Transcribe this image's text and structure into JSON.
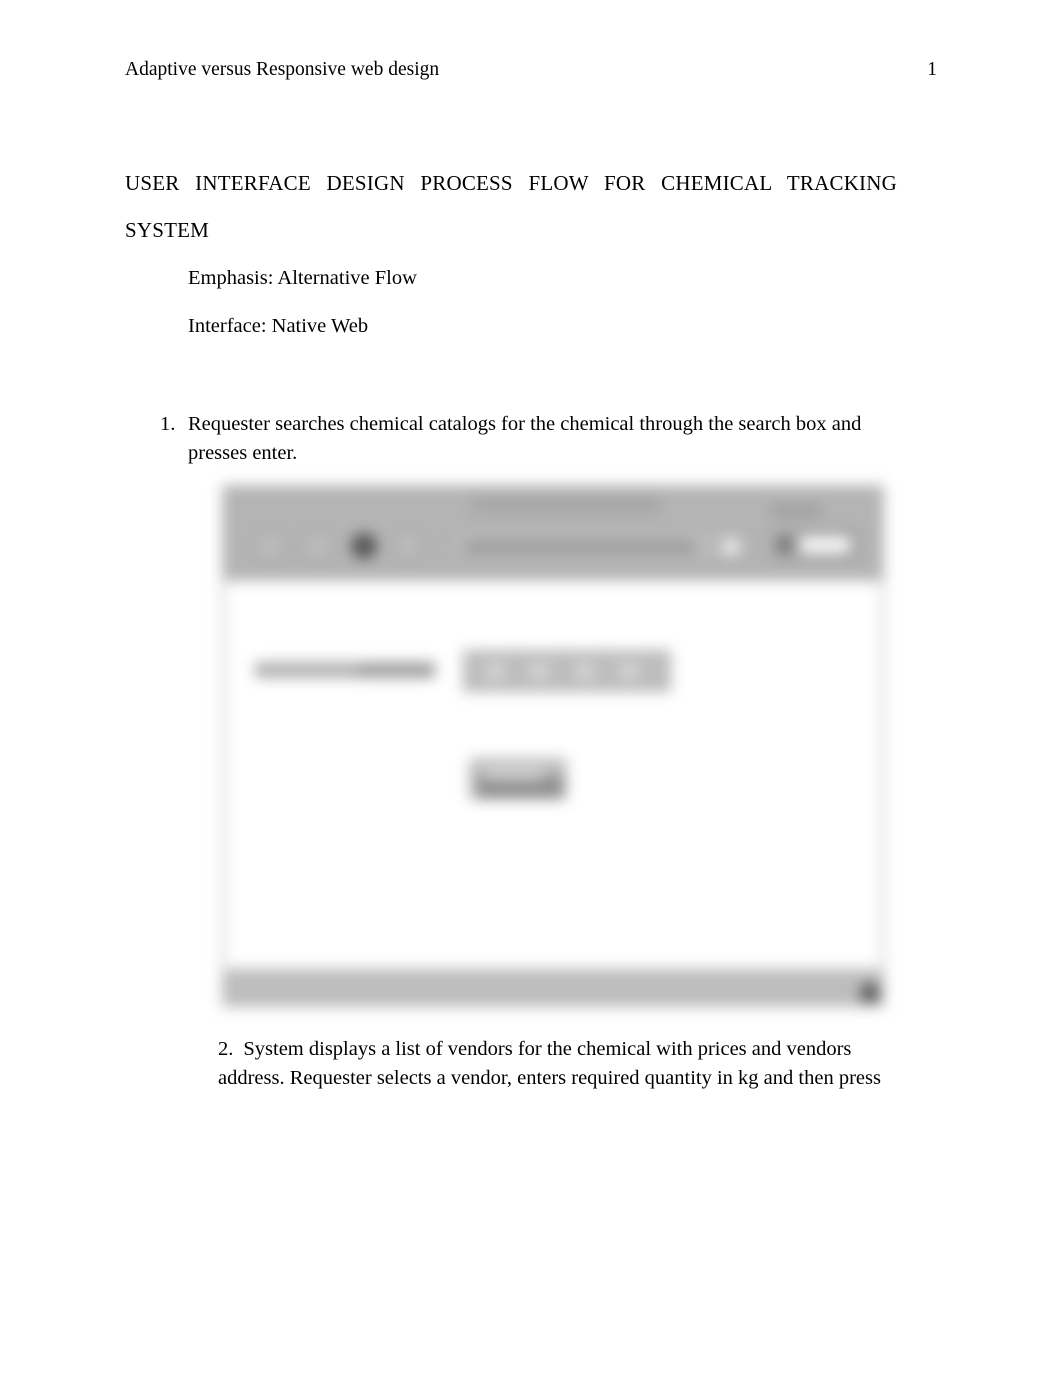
{
  "header": {
    "title": "Adaptive versus Responsive web design",
    "page_number": "1"
  },
  "document": {
    "title_line_1": "USER INTERFACE DESIGN PROCESS FLOW FOR CHEMICAL TRACKING",
    "title_line_2": "SYSTEM",
    "meta": [
      "Emphasis: Alternative Flow",
      "Interface: Native Web"
    ],
    "steps": [
      {
        "marker": "1.",
        "text": "Requester searches chemical catalogs for the chemical through the search box and presses enter."
      },
      {
        "marker": "2.",
        "text": "System displays a list of vendors for the chemical with prices and vendors address. Requester selects a vendor, enters required quantity in kg and then press"
      }
    ]
  },
  "figure": {
    "caption": "",
    "description": "Blurred screenshot of a web browser window showing a chemical search page",
    "browser": {
      "tab_title": "",
      "address_value": "",
      "nav_icons": [
        "back-icon",
        "forward-icon",
        "stop-icon",
        "home-icon"
      ],
      "toolbar_button_label": ""
    },
    "page_content": {
      "field_label": "",
      "search_input_value": "",
      "button_label": ""
    }
  },
  "colors": {
    "page_background": "#ffffff",
    "text": "#000000",
    "chrome_gray": "#b4b4b4",
    "status_gray": "#bdbdbd",
    "control_gray": "#bfbfbf"
  }
}
